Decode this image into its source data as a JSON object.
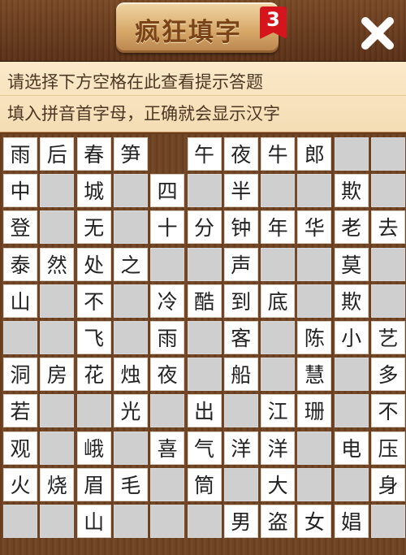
{
  "header": {
    "title": "疯狂填字",
    "level": "3",
    "close_label": "close"
  },
  "hints": {
    "line1": "请选择下方空格在此查看提示答题",
    "line2": "填入拼音首字母，正确就会显示汉字"
  },
  "board": {
    "rows": [
      [
        "雨",
        "后",
        "春",
        "笋",
        null,
        "午",
        "夜",
        "牛",
        "郎",
        "",
        ""
      ],
      [
        "中",
        "",
        "城",
        "",
        "四",
        "",
        "半",
        "",
        "",
        "欺",
        ""
      ],
      [
        "登",
        "",
        "无",
        "",
        "十",
        "分",
        "钟",
        "年",
        "华",
        "老",
        "去"
      ],
      [
        "泰",
        "然",
        "处",
        "之",
        "",
        "",
        "声",
        "",
        "",
        "莫",
        ""
      ],
      [
        "山",
        "",
        "不",
        "",
        "冷",
        "酷",
        "到",
        "底",
        "",
        "欺",
        ""
      ],
      [
        "",
        "",
        "飞",
        "",
        "雨",
        "",
        "客",
        "",
        "陈",
        "小",
        "艺"
      ],
      [
        "洞",
        "房",
        "花",
        "烛",
        "夜",
        "",
        "船",
        "",
        "慧",
        "",
        "多"
      ],
      [
        "若",
        "",
        "",
        "光",
        "",
        "出",
        "",
        "江",
        "珊",
        "",
        "不"
      ],
      [
        "观",
        "",
        "峨",
        "",
        "喜",
        "气",
        "洋",
        "洋",
        "",
        "电",
        "压"
      ],
      [
        "火",
        "烧",
        "眉",
        "毛",
        "",
        "筒",
        "",
        "大",
        "",
        "",
        "身"
      ],
      [
        "",
        "",
        "山",
        "",
        "",
        "",
        "男",
        "盗",
        "女",
        "娼",
        ""
      ]
    ]
  }
}
